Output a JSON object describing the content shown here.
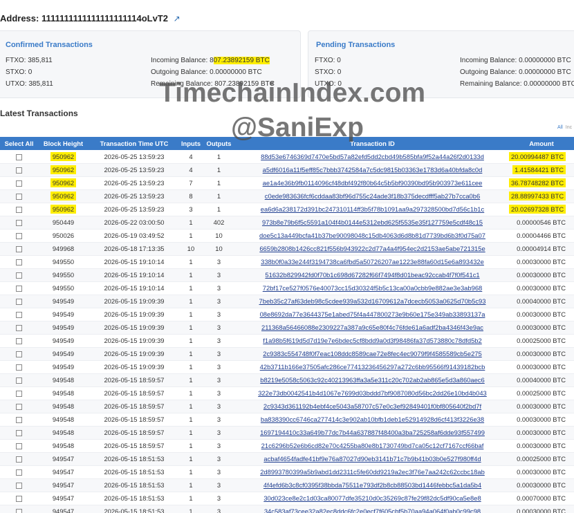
{
  "address": {
    "label": "Address:",
    "value": "1111111111111111111114oLvT2",
    "icon": "external-link-icon"
  },
  "confirmed": {
    "title": "Confirmed Transactions",
    "ftxo_label": "FTXO:",
    "ftxo": "385,811",
    "stxo_label": "STXO:",
    "stxo": "0",
    "utxo_label": "UTXO:",
    "utxo": "385,811",
    "incoming_label": "Incoming Balance:",
    "incoming_a": "8",
    "incoming_b": "07.23892159 BTC",
    "outgoing_label": "Outgoing Balance:",
    "outgoing": "0.00000000 BTC",
    "remaining_label": "Remaining Balance:",
    "remaining": "807.23892159 BTC"
  },
  "pending": {
    "title": "Pending Transactions",
    "ftxo_label": "FTXO:",
    "ftxo": "0",
    "stxo_label": "STXO:",
    "stxo": "0",
    "utxo_label": "UTXO:",
    "utxo": "0",
    "incoming_label": "Incoming Balance:",
    "incoming": "0.00000000 BTC",
    "outgoing_label": "Outgoing Balance:",
    "outgoing": "0.00000000 BTC",
    "remaining_label": "Remaining Balance:",
    "remaining": "0.00000000 BTC"
  },
  "section_title": "Latest Transactions",
  "links": {
    "all": "All",
    "inc": "Inc"
  },
  "table": {
    "headers": {
      "select_all": "Select All",
      "block": "Block Height",
      "time": "Transaction Time UTC",
      "inputs": "Inputs",
      "outputs": "Outputs",
      "txid": "Transaction ID",
      "amount": "Amount"
    },
    "rows": [
      {
        "block": "950962",
        "time": "2026-05-25 13:59:23",
        "inputs": "4",
        "outputs": "1",
        "txid": "88d53e6746369d7470e5bd57a82efd5dd2cbd49b585bfa9f52a44a26f2d0133d",
        "amount": "20.00994487 BTC",
        "highlight": true
      },
      {
        "block": "950962",
        "time": "2026-05-25 13:59:23",
        "inputs": "4",
        "outputs": "1",
        "txid": "a5df6016a11f5eff85c7bbb3742584a7c5dc9815b03363e1783d6a40bfda8c0d",
        "amount": "1.41584421 BTC",
        "highlight": true
      },
      {
        "block": "950962",
        "time": "2026-05-25 13:59:23",
        "inputs": "7",
        "outputs": "1",
        "txid": "ae1a4e36b9fb0114096cf48dbf492f80b64c5b5bf90390bd95b903973e611cee",
        "amount": "36.78748282 BTC",
        "highlight": true
      },
      {
        "block": "950962",
        "time": "2026-05-25 13:59:23",
        "inputs": "8",
        "outputs": "1",
        "txid": "c0ede983636fcf6cddaa83bf96d755c24ade3f18b375decdfff5ab27b7cca0b6",
        "amount": "28.88997433 BTC",
        "highlight": true
      },
      {
        "block": "950962",
        "time": "2026-05-25 13:59:23",
        "inputs": "3",
        "outputs": "1",
        "txid": "ea6d6a238172d391bc247310114ff3b5f78b1091aa9a297328500bd7d56c1b1c",
        "amount": "20.02697328 BTC",
        "highlight": true
      },
      {
        "block": "950449",
        "time": "2026-05-22 03:00:50",
        "inputs": "1",
        "outputs": "402",
        "txid": "973b8e79b6f5c5591a104f4b0144e5312ebd625f5535e35f127759e5cdf48c15",
        "amount": "0.00000546 BTC",
        "highlight": false
      },
      {
        "block": "950026",
        "time": "2026-05-19 03:49:52",
        "inputs": "1",
        "outputs": "10",
        "txid": "doe5c13a449bcfa41b37be90098048c15db4063d6d8b81d7739bd6b3f0d75a07",
        "amount": "0.00004466 BTC",
        "highlight": false
      },
      {
        "block": "949968",
        "time": "2026-05-18 17:13:35",
        "inputs": "10",
        "outputs": "10",
        "txid": "6659b2808b1426cc821f556b943922c2d77a4a4f954ec2d2153ae5abe721315e",
        "amount": "0.00004914 BTC",
        "highlight": false
      },
      {
        "block": "949550",
        "time": "2026-05-15 19:10:14",
        "inputs": "1",
        "outputs": "3",
        "txid": "338b0f0a33e244f3194738ca6fbd5a50726207ae1223e88fa60d15e6a893432e",
        "amount": "0.00030000 BTC",
        "highlight": false
      },
      {
        "block": "949550",
        "time": "2026-05-15 19:10:14",
        "inputs": "1",
        "outputs": "3",
        "txid": "51632b829942fd0f70b1c698d67282f66f7494f8d01beac92ccab4f7f0f541c1",
        "amount": "0.00030000 BTC",
        "highlight": false
      },
      {
        "block": "949550",
        "time": "2026-05-15 19:10:14",
        "inputs": "1",
        "outputs": "3",
        "txid": "72bf17ce527f0576e40073cc15d30324f5b5c13ca00a0cbb9e882ae3e3ab968",
        "amount": "0.00030000 BTC",
        "highlight": false
      },
      {
        "block": "949549",
        "time": "2026-05-15 19:09:39",
        "inputs": "1",
        "outputs": "3",
        "txid": "7beb35c27af63deb98c5cdee939a532d16709612a7dcecb5053a0625d70b5c93",
        "amount": "0.00040000 BTC",
        "highlight": false
      },
      {
        "block": "949549",
        "time": "2026-05-15 19:09:39",
        "inputs": "1",
        "outputs": "3",
        "txid": "08e8692da77e3644375e1abed75f4a447800273e9b60e175e349ab33893137a",
        "amount": "0.00030000 BTC",
        "highlight": false
      },
      {
        "block": "949549",
        "time": "2026-05-15 19:09:39",
        "inputs": "1",
        "outputs": "3",
        "txid": "211368a56466088e2309227a387a9c65e80f4c76fde61a6adf2ba4346f43e9ac",
        "amount": "0.00030000 BTC",
        "highlight": false
      },
      {
        "block": "949549",
        "time": "2026-05-15 19:09:39",
        "inputs": "1",
        "outputs": "3",
        "txid": "f1a98b5f619d5d7d19e7e6bdec5cf8bdd9a0d3f98486fa37d573880c78dfd5b2",
        "amount": "0.00025000 BTC",
        "highlight": false
      },
      {
        "block": "949549",
        "time": "2026-05-15 19:09:39",
        "inputs": "1",
        "outputs": "3",
        "txid": "2c9383c554748f0f7eac108ddc8589cae72e8fec4ec9079f9f4585589cb5e275",
        "amount": "0.00030000 BTC",
        "highlight": false
      },
      {
        "block": "949549",
        "time": "2026-05-15 19:09:39",
        "inputs": "1",
        "outputs": "3",
        "txid": "42b3711b166e37505afc286ce77413236456297a272c6bb95566f91439182bcb",
        "amount": "0.00030000 BTC",
        "highlight": false
      },
      {
        "block": "949548",
        "time": "2026-05-15 18:59:57",
        "inputs": "1",
        "outputs": "3",
        "txid": "b8219e5058c5063c92c40213963ffa3a5e311c20c702ab2ab865e5d3a860aec6",
        "amount": "0.00040000 BTC",
        "highlight": false
      },
      {
        "block": "949548",
        "time": "2026-05-15 18:59:57",
        "inputs": "1",
        "outputs": "3",
        "txid": "322e73db0042541b4d1067e7699d03bddd7bf9087080d56bc2dd26e10bd4b043",
        "amount": "0.00025000 BTC",
        "highlight": false
      },
      {
        "block": "949548",
        "time": "2026-05-15 18:59:57",
        "inputs": "1",
        "outputs": "3",
        "txid": "2c9343d361192b4ebf4ce5043a58707c57e0c3ef92849401f0bf805640f2bd7f",
        "amount": "0.00030000 BTC",
        "highlight": false
      },
      {
        "block": "949548",
        "time": "2026-05-15 18:59:57",
        "inputs": "1",
        "outputs": "3",
        "txid": "ba838390cc6746ca277414c3e902ab10bfb1deb1e52914928d6cf413f3226e38",
        "amount": "0.00030000 BTC",
        "highlight": false
      },
      {
        "block": "949548",
        "time": "2026-05-15 18:59:57",
        "inputs": "1",
        "outputs": "3",
        "txid": "1697194410c33a649b77dc7b44a637887f48400a3ba725258af6dde93f557499",
        "amount": "0.00030000 BTC",
        "highlight": false
      },
      {
        "block": "949548",
        "time": "2026-05-15 18:59:57",
        "inputs": "1",
        "outputs": "3",
        "txid": "21c6296b52e6b6cd82e70c4255ba80e8b1730749bd7ca05c12cf7167ccf66baf",
        "amount": "0.00030000 BTC",
        "highlight": false
      },
      {
        "block": "949547",
        "time": "2026-05-15 18:51:53",
        "inputs": "1",
        "outputs": "3",
        "txid": "acbaf4654fadfe41bf9e76a87027d90eb3141b71c7b9b41b03b0e527f980ff4d",
        "amount": "0.00025000 BTC",
        "highlight": false
      },
      {
        "block": "949547",
        "time": "2026-05-15 18:51:53",
        "inputs": "1",
        "outputs": "3",
        "txid": "2d8993780399a5b9abd1dd2311c5fe60dd9219a2ec3f76e7aa242c62ccbc18ab",
        "amount": "0.00030000 BTC",
        "highlight": false
      },
      {
        "block": "949547",
        "time": "2026-05-15 18:51:53",
        "inputs": "1",
        "outputs": "3",
        "txid": "4f4efd6b3c8cf0395f38bbda75511e793df2b8cb88503bd1446febbc5a1da5b4",
        "amount": "0.00030000 BTC",
        "highlight": false
      },
      {
        "block": "949547",
        "time": "2026-05-15 18:51:53",
        "inputs": "1",
        "outputs": "3",
        "txid": "30d023ce8e2c1d03ca80077dfe35210d0c35269c87fe29f82dc5df90ca5e8e8",
        "amount": "0.00070000 BTC",
        "highlight": false
      },
      {
        "block": "949547",
        "time": "2026-05-15 18:51:53",
        "inputs": "1",
        "outputs": "3",
        "txid": "34c583af73cee32a82ec8ddc6fc2e0ecf7f605cbf5b70aa94a064f0ab0c99c98",
        "amount": "0.00030000 BTC",
        "highlight": false
      }
    ]
  },
  "watermark": {
    "line1": "TimechainIndex.com",
    "line2": "@SaniExp"
  }
}
